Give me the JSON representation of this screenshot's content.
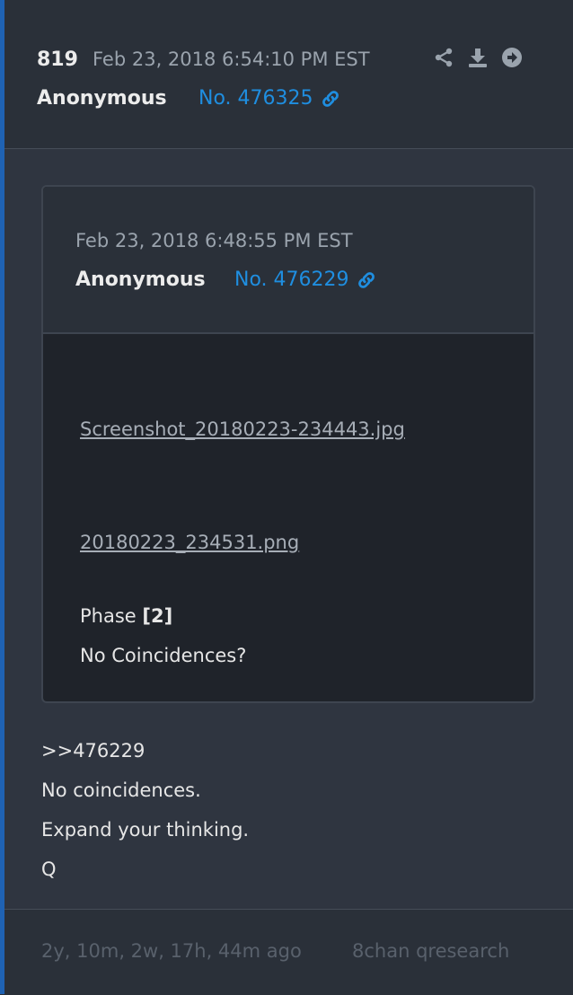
{
  "post": {
    "number": "819",
    "date": "Feb 23, 2018 6:54:10 PM EST",
    "author": "Anonymous",
    "id_label": "No. 476325",
    "actions": [
      "share-icon",
      "download-icon",
      "arrow-right-circle-icon"
    ]
  },
  "quoted": {
    "date": "Feb 23, 2018 6:48:55 PM EST",
    "author": "Anonymous",
    "id_label": "No. 476229",
    "files": [
      "Screenshot_20180223-234443.jpg",
      "20180223_234531.png"
    ],
    "text_prefix": "Phase ",
    "text_bold": "[2]",
    "text_line2": "No Coincidences?"
  },
  "reply": {
    "lines": [
      ">>476229",
      "No coincidences.",
      "Expand your thinking.",
      "Q"
    ]
  },
  "footer": {
    "ago": "2y, 10m, 2w, 17h, 44m ago",
    "source": "8chan qresearch"
  },
  "colors": {
    "accent": "#1f62b3",
    "link": "#1f8ee0",
    "background": "#2e3440"
  }
}
